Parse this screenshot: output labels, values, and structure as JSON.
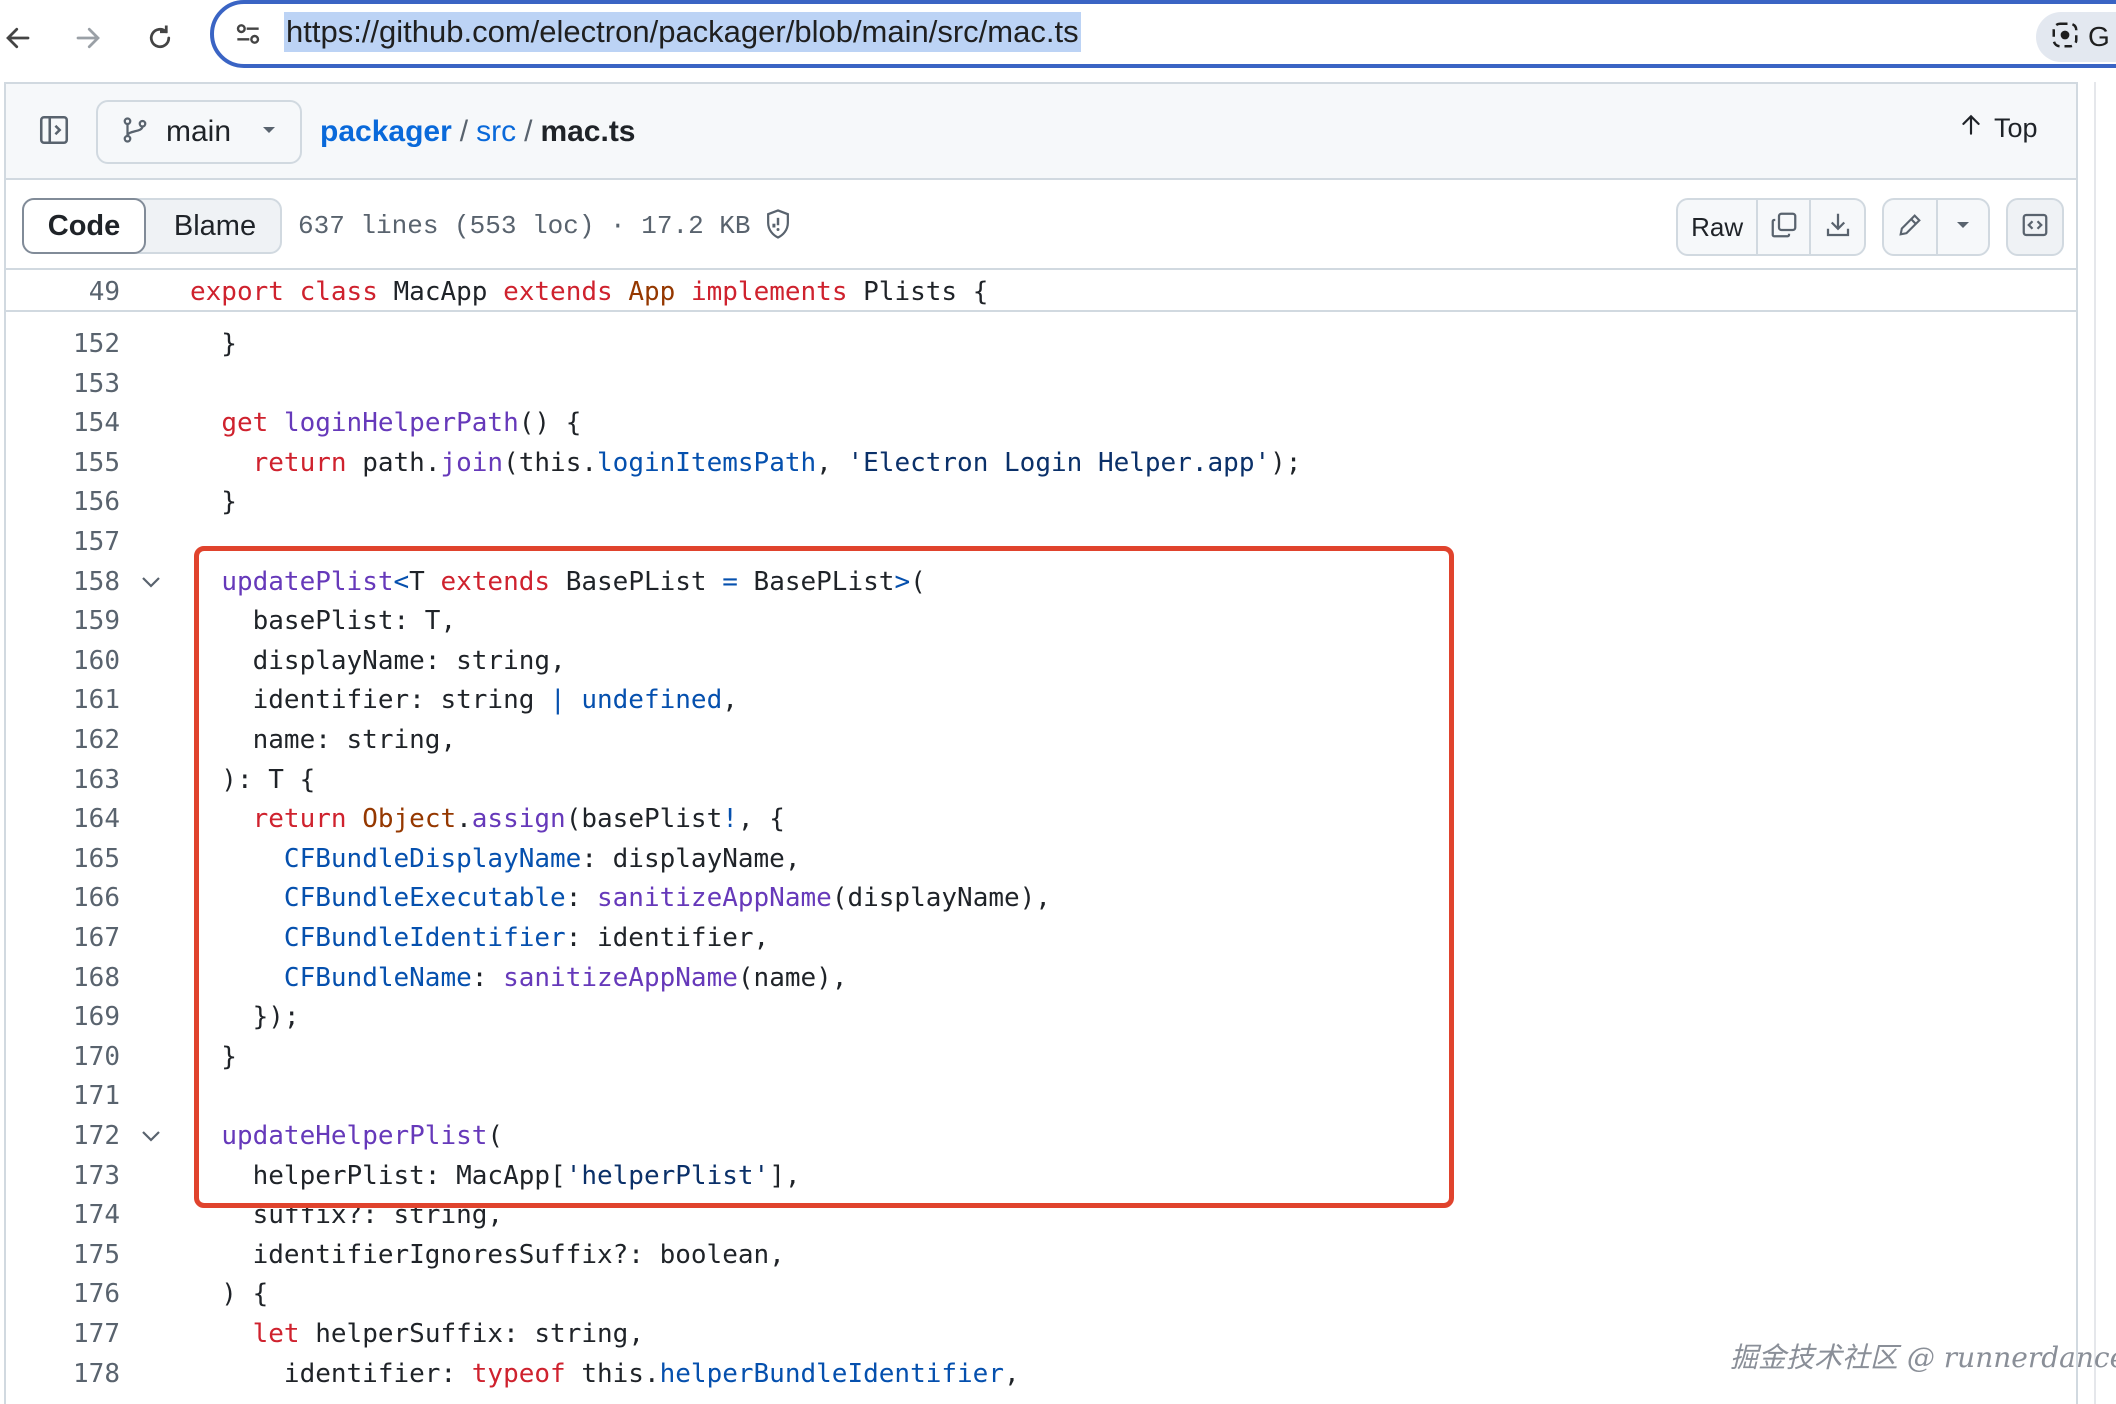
{
  "browser": {
    "url": "https://github.com/electron/packager/blob/main/src/mac.ts",
    "lens_letter": "G"
  },
  "file_header": {
    "branch": "main",
    "breadcrumb": {
      "repo": "packager",
      "folder": "src",
      "file": "mac.ts",
      "separator": "/"
    },
    "top_label": "Top"
  },
  "toolbar": {
    "tabs": [
      "Code",
      "Blame"
    ],
    "active_tab": "Code",
    "file_info": "637 lines (553 loc) · 17.2 KB ·",
    "raw_label": "Raw"
  },
  "sticky": {
    "line_number": "49",
    "tokens": [
      {
        "c": "k",
        "t": "export"
      },
      {
        "c": "",
        "t": " "
      },
      {
        "c": "k",
        "t": "class"
      },
      {
        "c": "",
        "t": " MacApp "
      },
      {
        "c": "k",
        "t": "extends"
      },
      {
        "c": "",
        "t": " "
      },
      {
        "c": "t",
        "t": "App"
      },
      {
        "c": "",
        "t": " "
      },
      {
        "c": "k",
        "t": "implements"
      },
      {
        "c": "",
        "t": " Plists {"
      }
    ]
  },
  "code_lines": [
    {
      "n": "152",
      "fold": false,
      "tokens": [
        {
          "c": "",
          "t": "  }"
        }
      ]
    },
    {
      "n": "153",
      "fold": false,
      "tokens": []
    },
    {
      "n": "154",
      "fold": false,
      "tokens": [
        {
          "c": "",
          "t": "  "
        },
        {
          "c": "k",
          "t": "get"
        },
        {
          "c": "",
          "t": " "
        },
        {
          "c": "f",
          "t": "loginHelperPath"
        },
        {
          "c": "",
          "t": "() {"
        }
      ]
    },
    {
      "n": "155",
      "fold": false,
      "tokens": [
        {
          "c": "",
          "t": "    "
        },
        {
          "c": "k",
          "t": "return"
        },
        {
          "c": "",
          "t": " path."
        },
        {
          "c": "f",
          "t": "join"
        },
        {
          "c": "",
          "t": "(this."
        },
        {
          "c": "p",
          "t": "loginItemsPath"
        },
        {
          "c": "",
          "t": ", "
        },
        {
          "c": "s",
          "t": "'Electron Login Helper.app'"
        },
        {
          "c": "",
          "t": ");"
        }
      ]
    },
    {
      "n": "156",
      "fold": false,
      "tokens": [
        {
          "c": "",
          "t": "  }"
        }
      ]
    },
    {
      "n": "157",
      "fold": false,
      "tokens": []
    },
    {
      "n": "158",
      "fold": true,
      "tokens": [
        {
          "c": "",
          "t": "  "
        },
        {
          "c": "f",
          "t": "updatePlist"
        },
        {
          "c": "p",
          "t": "<"
        },
        {
          "c": "",
          "t": "T "
        },
        {
          "c": "k",
          "t": "extends"
        },
        {
          "c": "",
          "t": " BasePList "
        },
        {
          "c": "p",
          "t": "="
        },
        {
          "c": "",
          "t": " BasePList"
        },
        {
          "c": "p",
          "t": ">"
        },
        {
          "c": "",
          "t": "("
        }
      ]
    },
    {
      "n": "159",
      "fold": false,
      "tokens": [
        {
          "c": "",
          "t": "    basePlist: T,"
        }
      ]
    },
    {
      "n": "160",
      "fold": false,
      "tokens": [
        {
          "c": "",
          "t": "    displayName: string,"
        }
      ]
    },
    {
      "n": "161",
      "fold": false,
      "tokens": [
        {
          "c": "",
          "t": "    identifier: string "
        },
        {
          "c": "p",
          "t": "|"
        },
        {
          "c": "",
          "t": " "
        },
        {
          "c": "p",
          "t": "undefined"
        },
        {
          "c": "",
          "t": ","
        }
      ]
    },
    {
      "n": "162",
      "fold": false,
      "tokens": [
        {
          "c": "",
          "t": "    name: string,"
        }
      ]
    },
    {
      "n": "163",
      "fold": false,
      "tokens": [
        {
          "c": "",
          "t": "  ): T {"
        }
      ]
    },
    {
      "n": "164",
      "fold": false,
      "tokens": [
        {
          "c": "",
          "t": "    "
        },
        {
          "c": "k",
          "t": "return"
        },
        {
          "c": "",
          "t": " "
        },
        {
          "c": "t",
          "t": "Object"
        },
        {
          "c": "",
          "t": "."
        },
        {
          "c": "f",
          "t": "assign"
        },
        {
          "c": "",
          "t": "(basePlist"
        },
        {
          "c": "p",
          "t": "!"
        },
        {
          "c": "",
          "t": ", {"
        }
      ]
    },
    {
      "n": "165",
      "fold": false,
      "tokens": [
        {
          "c": "",
          "t": "      "
        },
        {
          "c": "p",
          "t": "CFBundleDisplayName"
        },
        {
          "c": "",
          "t": ": displayName,"
        }
      ]
    },
    {
      "n": "166",
      "fold": false,
      "tokens": [
        {
          "c": "",
          "t": "      "
        },
        {
          "c": "p",
          "t": "CFBundleExecutable"
        },
        {
          "c": "",
          "t": ": "
        },
        {
          "c": "f",
          "t": "sanitizeAppName"
        },
        {
          "c": "",
          "t": "(displayName),"
        }
      ]
    },
    {
      "n": "167",
      "fold": false,
      "tokens": [
        {
          "c": "",
          "t": "      "
        },
        {
          "c": "p",
          "t": "CFBundleIdentifier"
        },
        {
          "c": "",
          "t": ": identifier,"
        }
      ]
    },
    {
      "n": "168",
      "fold": false,
      "tokens": [
        {
          "c": "",
          "t": "      "
        },
        {
          "c": "p",
          "t": "CFBundleName"
        },
        {
          "c": "",
          "t": ": "
        },
        {
          "c": "f",
          "t": "sanitizeAppName"
        },
        {
          "c": "",
          "t": "(name),"
        }
      ]
    },
    {
      "n": "169",
      "fold": false,
      "tokens": [
        {
          "c": "",
          "t": "    });"
        }
      ]
    },
    {
      "n": "170",
      "fold": false,
      "tokens": [
        {
          "c": "",
          "t": "  }"
        }
      ]
    },
    {
      "n": "171",
      "fold": false,
      "tokens": []
    },
    {
      "n": "172",
      "fold": true,
      "tokens": [
        {
          "c": "",
          "t": "  "
        },
        {
          "c": "f",
          "t": "updateHelperPlist"
        },
        {
          "c": "",
          "t": "("
        }
      ]
    },
    {
      "n": "173",
      "fold": false,
      "tokens": [
        {
          "c": "",
          "t": "    helperPlist: MacApp["
        },
        {
          "c": "s",
          "t": "'helperPlist'"
        },
        {
          "c": "",
          "t": "],"
        }
      ]
    },
    {
      "n": "174",
      "fold": false,
      "tokens": [
        {
          "c": "",
          "t": "    suffix?: string,"
        }
      ]
    },
    {
      "n": "175",
      "fold": false,
      "tokens": [
        {
          "c": "",
          "t": "    identifierIgnoresSuffix?: boolean,"
        }
      ]
    },
    {
      "n": "176",
      "fold": false,
      "tokens": [
        {
          "c": "",
          "t": "  ) {"
        }
      ]
    },
    {
      "n": "177",
      "fold": false,
      "tokens": [
        {
          "c": "",
          "t": "    "
        },
        {
          "c": "k",
          "t": "let"
        },
        {
          "c": "",
          "t": " helperSuffix: string,"
        }
      ]
    },
    {
      "n": "178",
      "fold": false,
      "tokens": [
        {
          "c": "",
          "t": "      identifier: "
        },
        {
          "c": "k",
          "t": "typeof"
        },
        {
          "c": "",
          "t": " this."
        },
        {
          "c": "p",
          "t": "helperBundleIdentifier"
        },
        {
          "c": "",
          "t": ","
        }
      ]
    }
  ],
  "watermark": "掘金技术社区 @ runnerdancer",
  "colors": {
    "link": "#0969da",
    "highlight_box": "#e0432d",
    "url_bar_border": "#3a64c4"
  }
}
